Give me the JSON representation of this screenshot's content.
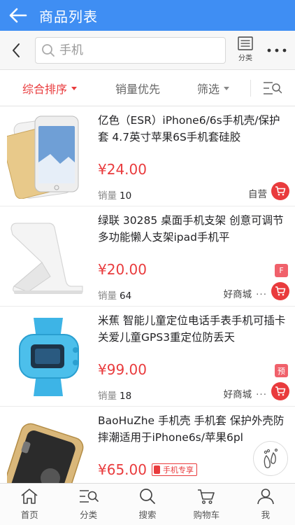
{
  "appbar": {
    "title": "商品列表"
  },
  "search": {
    "placeholder": "手机",
    "category_label": "分类"
  },
  "sort": {
    "composite": "综合排序",
    "sales_first": "销量优先",
    "filter": "筛选"
  },
  "products": [
    {
      "name": "亿色（ESR）iPhone6/6s手机壳/保护套 4.7英寸苹果6S手机套硅胶",
      "price": "¥24.00",
      "sales_label": "销量",
      "sales": "10",
      "shop": "自营",
      "thumb_icon": "clear-phone-case-image"
    },
    {
      "name": "绿联 30285 桌面手机支架 创意可调节多功能懒人支架ipad手机平",
      "price": "¥20.00",
      "sales_label": "销量",
      "sales": "64",
      "shop": "好商城",
      "tag": "F",
      "thumb_icon": "phone-stand-image"
    },
    {
      "name": "米蕉 智能儿童定位电话手表手机可插卡关爱儿童GPS3重定位防丢天",
      "price": "¥99.00",
      "sales_label": "销量",
      "sales": "18",
      "shop": "好商城",
      "tag": "预",
      "thumb_icon": "kids-watch-image"
    },
    {
      "name": "BaoHuZhe 手机壳 手机套 保护外壳防摔潮适用于iPhone6s/苹果6pl",
      "price": "¥65.00",
      "mobile_tag": "手机专享",
      "thumb_icon": "gold-phone-case-image"
    }
  ],
  "tabs": [
    {
      "label": "首页",
      "icon": "home-icon"
    },
    {
      "label": "分类",
      "icon": "category-icon"
    },
    {
      "label": "搜索",
      "icon": "search-icon"
    },
    {
      "label": "购物车",
      "icon": "cart-icon"
    },
    {
      "label": "我",
      "icon": "user-icon"
    }
  ],
  "colors": {
    "brand_blue": "#3f8ef3",
    "accent_red": "#e93b3d",
    "tag_red": "#f0616b",
    "watch_blue": "#3db4e6"
  }
}
